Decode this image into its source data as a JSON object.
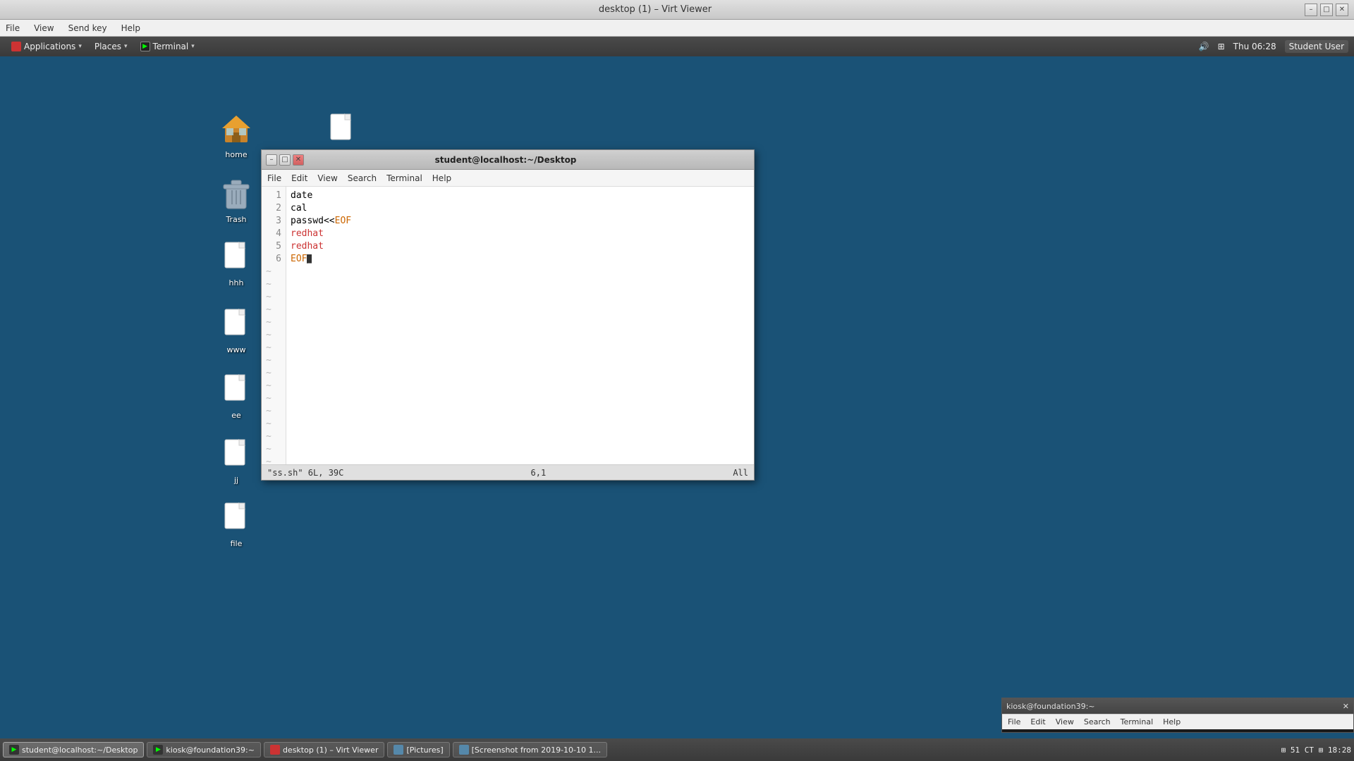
{
  "virt_viewer": {
    "title": "desktop (1) – Virt Viewer",
    "menu": {
      "file": "File",
      "view": "View",
      "send_key": "Send key",
      "help": "Help"
    },
    "controls": {
      "minimize": "–",
      "maximize": "□",
      "close": "✕"
    }
  },
  "guest": {
    "panel": {
      "applications": "Applications",
      "places": "Places",
      "terminal": "Terminal",
      "time": "Thu 06:28",
      "user": "Student User",
      "volume_icon": "🔊",
      "network_icon": "⊞"
    },
    "desktop_icons": [
      {
        "name": "home",
        "label": "home"
      },
      {
        "name": "blank1",
        "label": ""
      },
      {
        "name": "trash",
        "label": "Trash"
      },
      {
        "name": "hhh",
        "label": "hhh"
      },
      {
        "name": "www",
        "label": "www"
      },
      {
        "name": "ee",
        "label": "ee"
      },
      {
        "name": "jj",
        "label": "jj"
      },
      {
        "name": "file",
        "label": "file"
      }
    ],
    "vim_window": {
      "title": "student@localhost:~/Desktop",
      "menubar": [
        "File",
        "Edit",
        "View",
        "Search",
        "Terminal",
        "Help"
      ],
      "lines": [
        {
          "num": "1",
          "text": "date",
          "type": "normal"
        },
        {
          "num": "2",
          "text": "cal",
          "type": "normal"
        },
        {
          "num": "3",
          "text": "passwd<<EOF",
          "type": "heredoc"
        },
        {
          "num": "4",
          "text": "redhat",
          "type": "redhat"
        },
        {
          "num": "5",
          "text": "redhat",
          "type": "redhat"
        },
        {
          "num": "6",
          "text": "EOF",
          "type": "eof"
        }
      ],
      "statusbar_left": "\"ss.sh\" 6L, 39C",
      "statusbar_right": "6,1",
      "statusbar_pos": "All"
    },
    "mini_terminal": {
      "title": "kiosk@foundation39:~",
      "close": "✕"
    },
    "taskbar": [
      {
        "label": "student@localhost:~/Desktop",
        "icon": "T",
        "active": true
      },
      {
        "label": "kiosk@foundation39:~",
        "icon": "T",
        "active": false
      },
      {
        "label": "desktop (1) – Virt Viewer",
        "icon": "V",
        "active": false
      },
      {
        "label": "[Pictures]",
        "icon": "F",
        "active": false
      },
      {
        "label": "[Screenshot from 2019-10-10 1...",
        "icon": "S",
        "active": false
      }
    ],
    "taskbar_right": "⊞ 51 CT ⊞ 18:28"
  }
}
